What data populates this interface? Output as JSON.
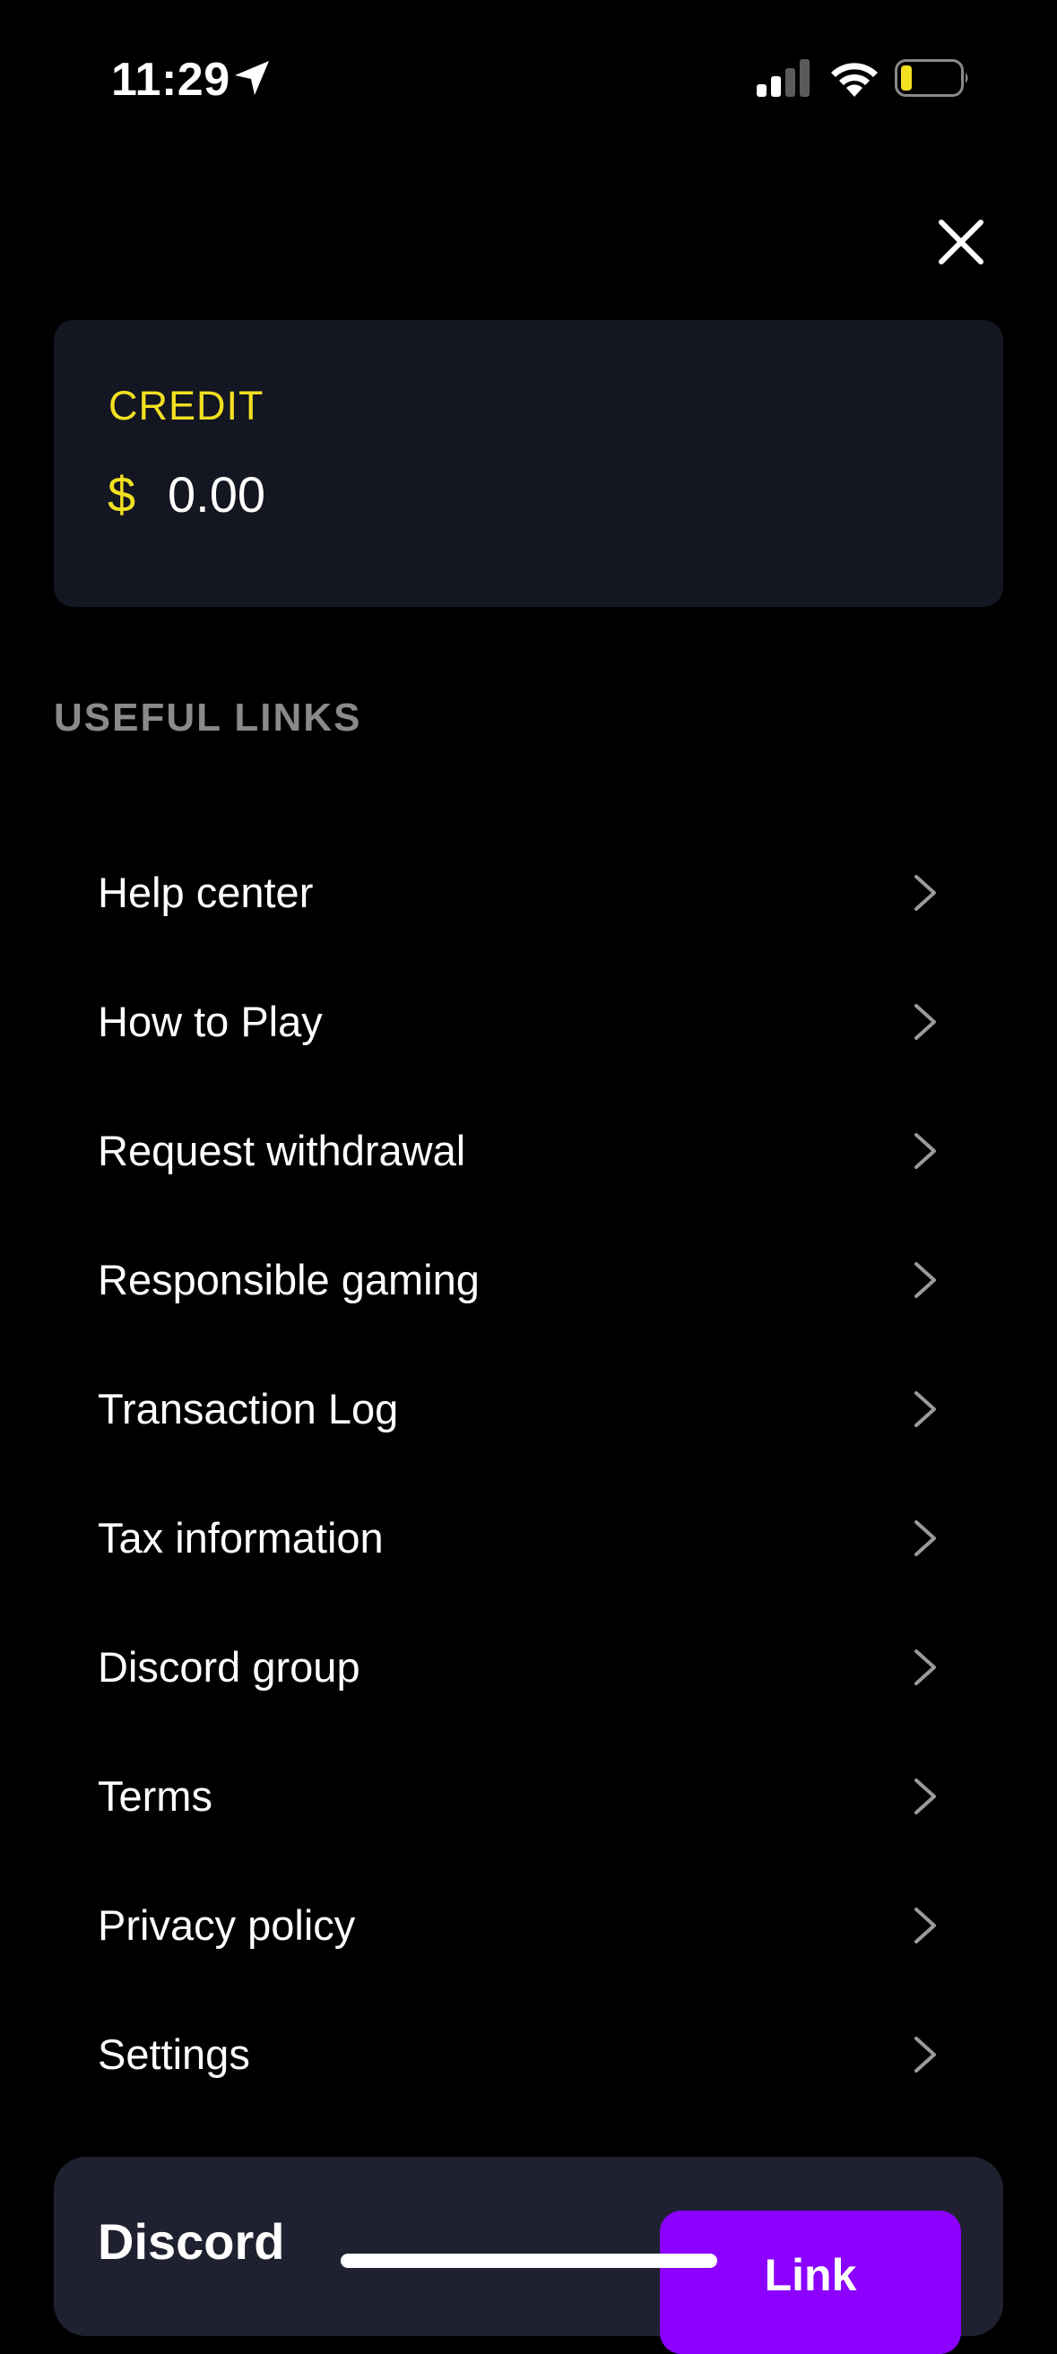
{
  "status_bar": {
    "time": "11:29",
    "icons": [
      "location-arrow-icon",
      "cellular-signal-icon",
      "wifi-icon",
      "battery-icon"
    ]
  },
  "header": {
    "close_icon": "close-icon"
  },
  "credit": {
    "label": "CREDIT",
    "currency": "$",
    "amount": "0.00"
  },
  "useful_links": {
    "title": "USEFUL LINKS",
    "items": [
      {
        "label": "Help center"
      },
      {
        "label": "How to Play"
      },
      {
        "label": "Request withdrawal"
      },
      {
        "label": "Responsible gaming"
      },
      {
        "label": "Transaction Log"
      },
      {
        "label": "Tax information"
      },
      {
        "label": "Discord group"
      },
      {
        "label": "Terms"
      },
      {
        "label": "Privacy policy"
      },
      {
        "label": "Settings"
      }
    ]
  },
  "discord": {
    "title": "Discord",
    "button_label": "Link"
  },
  "colors": {
    "accent_yellow": "#f2e021",
    "card_bg": "#141622",
    "discord_card_bg": "#1f2130",
    "link_button": "#8b00ff",
    "section_title": "#8a8a8a",
    "battery_level": "#f2e021"
  }
}
